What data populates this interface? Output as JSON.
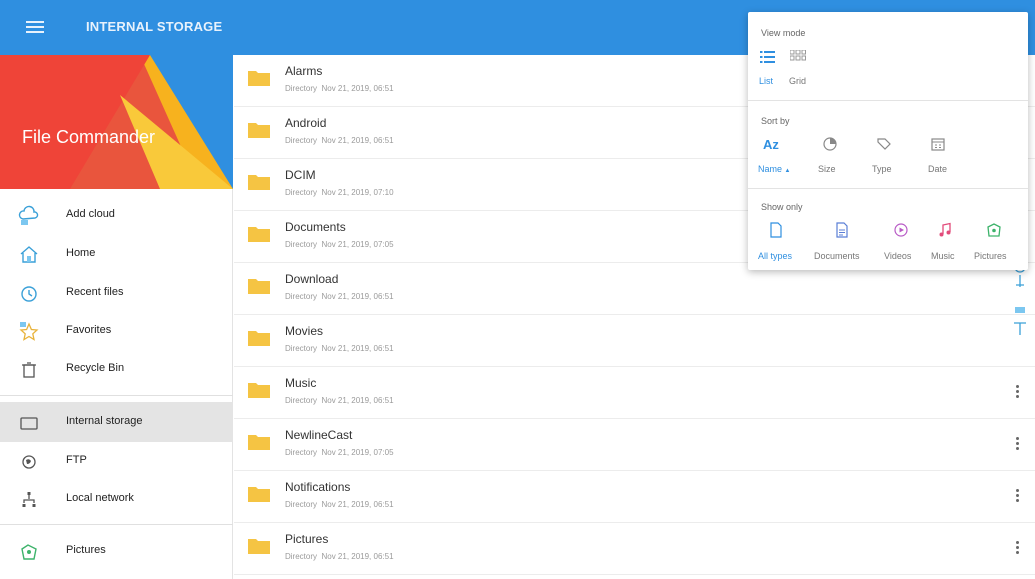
{
  "header": {
    "title": "INTERNAL STORAGE",
    "accent": "#2f8fe0"
  },
  "sidebar": {
    "brand": "File Commander",
    "items": [
      {
        "label": "Add cloud"
      },
      {
        "label": "Home"
      },
      {
        "label": "Recent files"
      },
      {
        "label": "Favorites"
      },
      {
        "label": "Recycle Bin"
      },
      {
        "label": "Internal storage",
        "active": true
      },
      {
        "label": "FTP"
      },
      {
        "label": "Local network"
      },
      {
        "label": "Pictures"
      }
    ]
  },
  "files": [
    {
      "name": "Alarms",
      "type": "Directory",
      "date": "Nov 21, 2019, 06:51"
    },
    {
      "name": "Android",
      "type": "Directory",
      "date": "Nov 21, 2019, 06:51"
    },
    {
      "name": "DCIM",
      "type": "Directory",
      "date": "Nov 21, 2019, 07:10"
    },
    {
      "name": "Documents",
      "type": "Directory",
      "date": "Nov 21, 2019, 07:05"
    },
    {
      "name": "Download",
      "type": "Directory",
      "date": "Nov 21, 2019, 06:51"
    },
    {
      "name": "Movies",
      "type": "Directory",
      "date": "Nov 21, 2019, 06:51"
    },
    {
      "name": "Music",
      "type": "Directory",
      "date": "Nov 21, 2019, 06:51"
    },
    {
      "name": "NewlineCast",
      "type": "Directory",
      "date": "Nov 21, 2019, 07:05"
    },
    {
      "name": "Notifications",
      "type": "Directory",
      "date": "Nov 21, 2019, 06:51"
    },
    {
      "name": "Pictures",
      "type": "Directory",
      "date": "Nov 21, 2019, 06:51"
    }
  ],
  "popup": {
    "view_mode": {
      "title": "View mode",
      "options": [
        "List",
        "Grid"
      ],
      "selected": "List"
    },
    "sort_by": {
      "title": "Sort by",
      "options": [
        "Name",
        "Size",
        "Type",
        "Date"
      ],
      "selected": "Name",
      "direction_glyph": "▲",
      "name_icon_text": "Az"
    },
    "show_only": {
      "title": "Show only",
      "options": [
        "All types",
        "Documents",
        "Videos",
        "Music",
        "Pictures"
      ],
      "selected": "All types"
    }
  },
  "colors": {
    "accent": "#2f8fe0",
    "folder": "#f5c443",
    "banner_red": "#ef4438",
    "banner_yellow": "#f7b21e",
    "banner_blue": "#2f8fe0"
  }
}
